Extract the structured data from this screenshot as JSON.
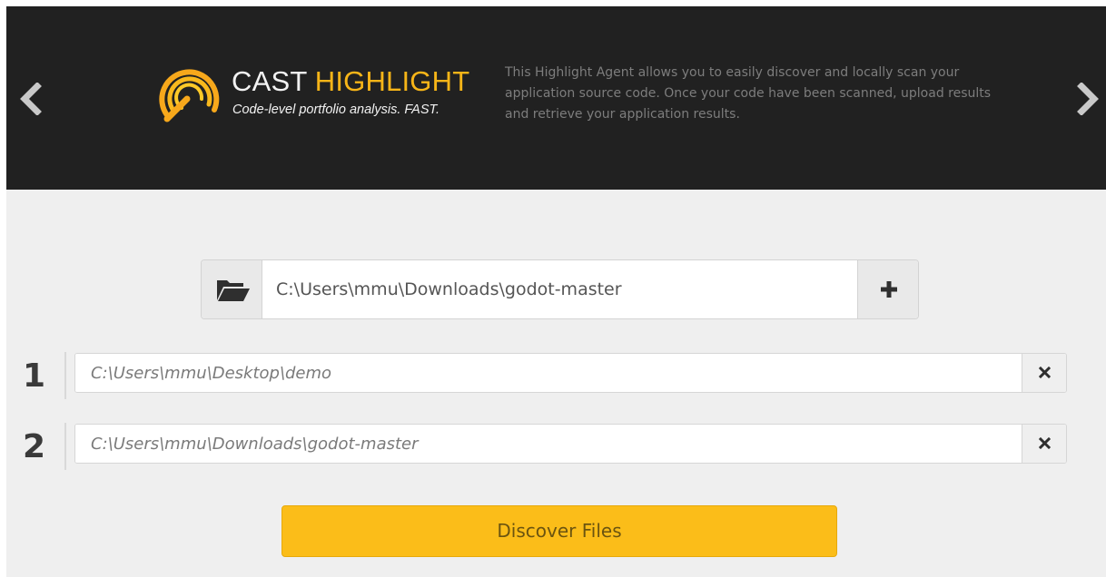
{
  "header": {
    "brand_cast": "CAST",
    "brand_highlight": "HIGHLIGHT",
    "tagline": "Code-level portfolio analysis. FAST.",
    "description": "This Highlight Agent allows you to easily discover and locally scan your application source code. Once your code have been scanned, upload results and retrieve your application results.",
    "prev_icon": "chevron-left-icon",
    "next_icon": "chevron-right-icon",
    "logo_icon": "cast-highlight-logo"
  },
  "path_entry": {
    "value": "C:\\Users\\mmu\\Downloads\\godot-master",
    "browse_icon": "folder-open-icon",
    "add_icon": "plus-icon"
  },
  "folders": [
    {
      "number": "1",
      "path": "C:\\Users\\mmu\\Desktop\\demo",
      "remove_icon": "close-icon"
    },
    {
      "number": "2",
      "path": "C:\\Users\\mmu\\Downloads\\godot-master",
      "remove_icon": "close-icon"
    }
  ],
  "actions": {
    "discover_label": "Discover Files"
  },
  "colors": {
    "header_bg": "#212121",
    "accent": "#f7b518",
    "button": "#fbbd19",
    "page_bg": "#efefef"
  }
}
